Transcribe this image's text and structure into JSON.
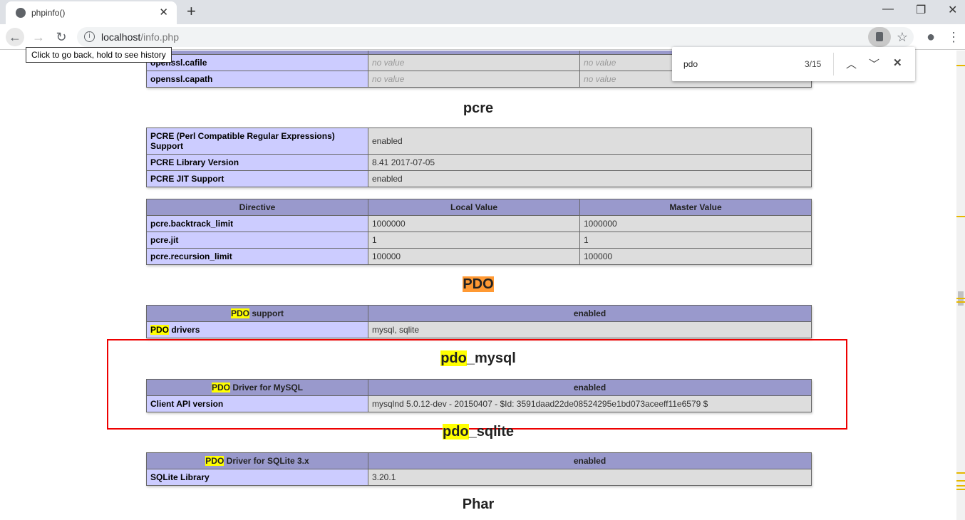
{
  "browser": {
    "tab_title": "phpinfo()",
    "url_host": "localhost",
    "url_path": "/info.php",
    "tooltip": "Click to go back, hold to see history"
  },
  "find": {
    "query": "pdo",
    "count": "3/15"
  },
  "openssl": {
    "rows": [
      [
        "openssl.cafile",
        "no value",
        "no value"
      ],
      [
        "openssl.capath",
        "no value",
        "no value"
      ]
    ]
  },
  "pcre": {
    "title": "pcre",
    "rows": [
      [
        "PCRE (Perl Compatible Regular Expressions) Support",
        "enabled"
      ],
      [
        "PCRE Library Version",
        "8.41 2017-07-05"
      ],
      [
        "PCRE JIT Support",
        "enabled"
      ]
    ],
    "directive_headers": [
      "Directive",
      "Local Value",
      "Master Value"
    ],
    "directives": [
      [
        "pcre.backtrack_limit",
        "1000000",
        "1000000"
      ],
      [
        "pcre.jit",
        "1",
        "1"
      ],
      [
        "pcre.recursion_limit",
        "100000",
        "100000"
      ]
    ]
  },
  "pdo": {
    "title": "PDO",
    "support_hl": "PDO",
    "support_rest": " support",
    "support_value": "enabled",
    "drivers_hl": "PDO",
    "drivers_rest": " drivers",
    "drivers_value": "mysql, sqlite"
  },
  "pdo_mysql": {
    "title_hl": "pdo",
    "title_rest": "_mysql",
    "driver_hl": "PDO",
    "driver_rest": " Driver for MySQL",
    "driver_value": "enabled",
    "client_label": "Client API version",
    "client_value": "mysqlnd 5.0.12-dev - 20150407 - $Id: 3591daad22de08524295e1bd073aceeff11e6579 $"
  },
  "pdo_sqlite": {
    "title_hl": "pdo",
    "title_rest": "_sqlite",
    "driver_hl": "PDO",
    "driver_rest": " Driver for SQLite 3.x",
    "driver_value": "enabled",
    "lib_label": "SQLite Library",
    "lib_value": "3.20.1"
  },
  "phar": {
    "title": "Phar"
  },
  "colors": {
    "highlight": "#ffff00",
    "active_highlight": "#ff9933",
    "annotation": "#ee0000"
  }
}
